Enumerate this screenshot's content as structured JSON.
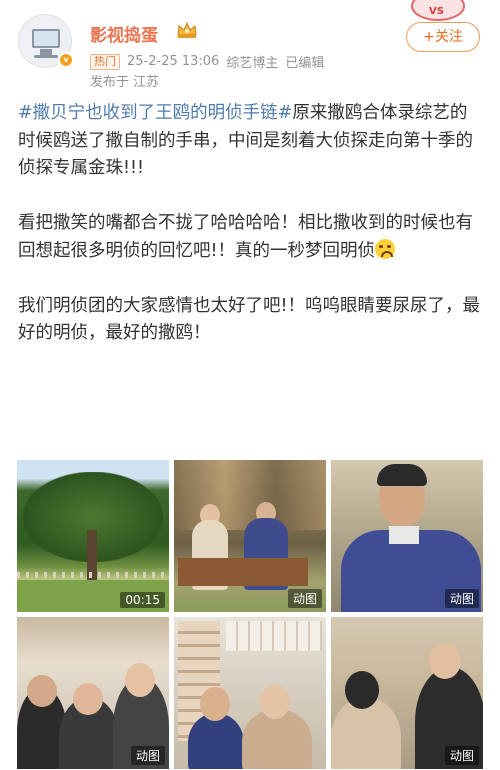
{
  "header": {
    "username": "影视捣蛋",
    "hot_tag": "热门",
    "datetime": "25-2-25 13:06",
    "role": "综艺博主",
    "edited": "已编辑",
    "location": "发布于 江苏",
    "follow_label": "+关注",
    "brand_color": "#eb7350"
  },
  "post": {
    "hashtag": "#撒贝宁也收到了王鸥的明侦手链#",
    "paragraph1": "原来撒鸥合体录综艺的时候鸥送了撒自制的手串，中间是刻着大侦探走向第十季的侦探专属金珠!!!",
    "paragraph2": "看把撒笑的嘴都合不拢了哈哈哈哈！相比撒收到的时候也有回想起很多明侦的回忆吧!！真的一秒梦回明侦",
    "paragraph3": "我们明侦团的大家感情也太好了吧!！呜呜眼睛要尿尿了，最好的明侦，最好的撒鸥！"
  },
  "media": [
    {
      "label": "00:15",
      "icon": "video-thumbnail"
    },
    {
      "label": "",
      "icon": "gif-thumbnail"
    },
    {
      "label": "动图",
      "icon": "gif-thumbnail"
    },
    {
      "label": "动图",
      "icon": "gif-thumbnail"
    },
    {
      "label": "",
      "icon": "gif-thumbnail"
    },
    {
      "label": "动图",
      "icon": "gif-thumbnail"
    }
  ],
  "media_badges": {
    "tile2": "动图"
  }
}
